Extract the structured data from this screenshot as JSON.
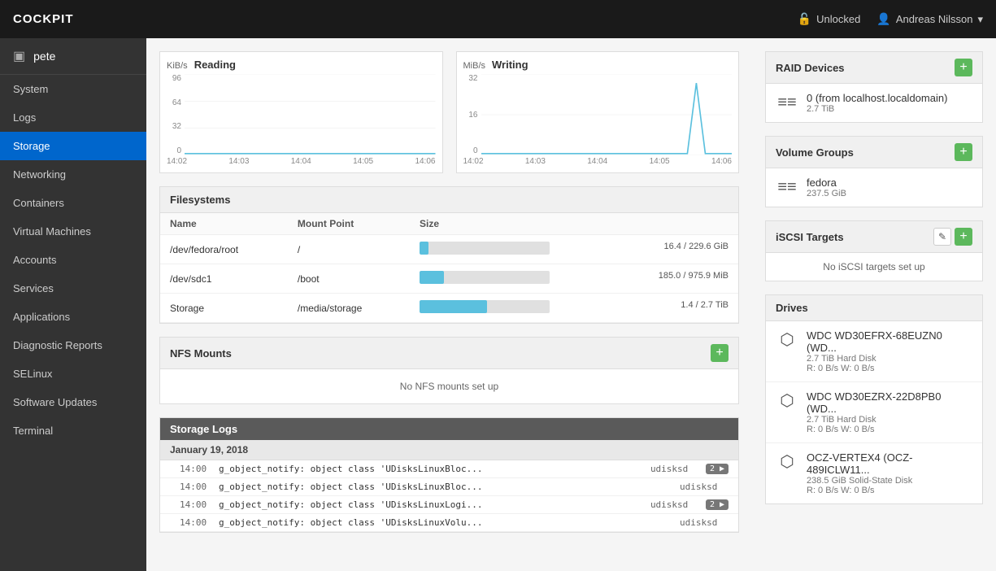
{
  "topnav": {
    "brand": "COCKPIT",
    "unlocked_label": "Unlocked",
    "user_label": "Andreas Nilsson",
    "user_dropdown_icon": "▾"
  },
  "sidebar": {
    "host_icon": "▣",
    "host_name": "pete",
    "items": [
      {
        "id": "system",
        "label": "System",
        "active": false
      },
      {
        "id": "logs",
        "label": "Logs",
        "active": false
      },
      {
        "id": "storage",
        "label": "Storage",
        "active": true
      },
      {
        "id": "networking",
        "label": "Networking",
        "active": false
      },
      {
        "id": "containers",
        "label": "Containers",
        "active": false
      },
      {
        "id": "virtual-machines",
        "label": "Virtual Machines",
        "active": false
      },
      {
        "id": "accounts",
        "label": "Accounts",
        "active": false
      },
      {
        "id": "services",
        "label": "Services",
        "active": false
      },
      {
        "id": "applications",
        "label": "Applications",
        "active": false
      },
      {
        "id": "diagnostic-reports",
        "label": "Diagnostic Reports",
        "active": false
      },
      {
        "id": "selinux",
        "label": "SELinux",
        "active": false
      },
      {
        "id": "software-updates",
        "label": "Software Updates",
        "active": false
      },
      {
        "id": "terminal",
        "label": "Terminal",
        "active": false
      }
    ]
  },
  "charts": {
    "reading": {
      "unit": "KiB/s",
      "title": "Reading",
      "y_labels": [
        "96",
        "64",
        "32",
        "0"
      ],
      "x_labels": [
        "14:02",
        "14:03",
        "14:04",
        "14:05",
        "14:06"
      ]
    },
    "writing": {
      "unit": "MiB/s",
      "title": "Writing",
      "y_labels": [
        "32",
        "16",
        "0"
      ],
      "x_labels": [
        "14:02",
        "14:03",
        "14:04",
        "14:05",
        "14:06"
      ]
    }
  },
  "filesystems": {
    "title": "Filesystems",
    "columns": [
      "Name",
      "Mount Point",
      "Size"
    ],
    "rows": [
      {
        "name": "/dev/fedora/root",
        "mount": "/",
        "size_label": "16.4 / 229.6 GiB",
        "pct": 7
      },
      {
        "name": "/dev/sdc1",
        "mount": "/boot",
        "size_label": "185.0 / 975.9 MiB",
        "pct": 19
      },
      {
        "name": "Storage",
        "mount": "/media/storage",
        "size_label": "1.4 / 2.7 TiB",
        "pct": 52
      }
    ]
  },
  "nfs_mounts": {
    "title": "NFS Mounts",
    "add_label": "+",
    "empty_label": "No NFS mounts set up"
  },
  "storage_logs": {
    "title": "Storage Logs",
    "date_label": "January 19, 2018",
    "rows": [
      {
        "time": "14:00",
        "msg": "g_object_notify: object class 'UDisksLinuxBloc...",
        "source": "udisksd",
        "badge": "2"
      },
      {
        "time": "14:00",
        "msg": "g_object_notify: object class 'UDisksLinuxBloc...",
        "source": "udisksd",
        "badge": null
      },
      {
        "time": "14:00",
        "msg": "g_object_notify: object class 'UDisksLinuxLogi...",
        "source": "udisksd",
        "badge": "2"
      },
      {
        "time": "14:00",
        "msg": "g_object_notify: object class 'UDisksLinuxVolu...",
        "source": "udisksd",
        "badge": null
      }
    ]
  },
  "right_sidebar": {
    "raid_devices": {
      "title": "RAID Devices",
      "add_label": "+",
      "items": [
        {
          "name": "0 (from localhost.localdomain)",
          "sub": "2.7 TiB"
        }
      ]
    },
    "volume_groups": {
      "title": "Volume Groups",
      "add_label": "+",
      "items": [
        {
          "name": "fedora",
          "sub": "237.5 GiB"
        }
      ]
    },
    "iscsi_targets": {
      "title": "iSCSI Targets",
      "edit_label": "✎",
      "add_label": "+",
      "empty_label": "No iSCSI targets set up"
    },
    "drives": {
      "title": "Drives",
      "items": [
        {
          "name": "WDC WD30EFRX-68EUZN0 (WD...",
          "sub": "2.7 TiB Hard Disk",
          "rw": "R: 0 B/s     W: 0 B/s"
        },
        {
          "name": "WDC WD30EZRX-22D8PB0 (WD...",
          "sub": "2.7 TiB Hard Disk",
          "rw": "R: 0 B/s     W: 0 B/s"
        },
        {
          "name": "OCZ-VERTEX4 (OCZ-489ICLW11...",
          "sub": "238.5 GiB Solid-State Disk",
          "rw": "R: 0 B/s     W: 0 B/s"
        }
      ]
    }
  }
}
